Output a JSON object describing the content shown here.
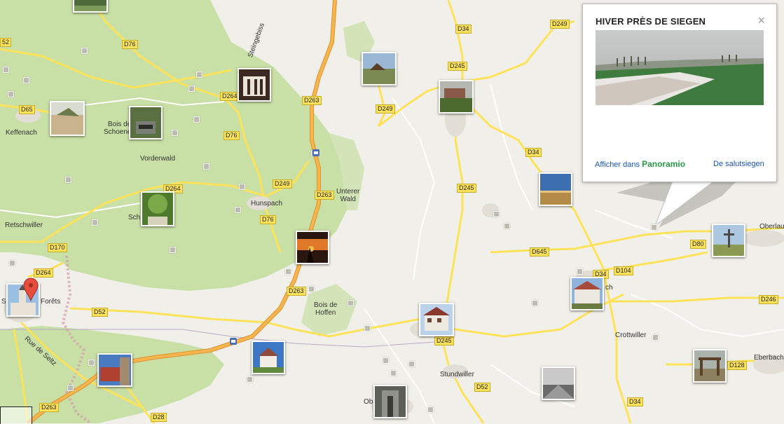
{
  "places": {
    "keffenach": "Keffenach",
    "bois_schoenen": "Bois de\nSchoenen",
    "vorderwald": "Vorderwald",
    "hunspach": "Hunspach",
    "retschwiller": "Retschwiller",
    "schoenenbourg_partial": "Sch",
    "forets": "Forêts",
    "forets_prefix": "Sc",
    "unterer_wald": "Unterer\nWald",
    "bois_hoffen": "Bois de\nHoffen",
    "crottwiller": "Crottwiller",
    "stundwiller": "Stundwiller",
    "oberlau": "Oberlau",
    "eberbach": "Eberbach",
    "ob_partial": "Ob",
    "ch_partial": "ch",
    "rue_seltz": "Rue de Seltz",
    "steingebiss": "Steingebiss"
  },
  "roads": {
    "d76a": "D76",
    "d76b": "D76",
    "d76c": "D76",
    "d65": "D65",
    "d52a": "52",
    "d264a": "D264",
    "d264b": "D264",
    "d264c": "D264",
    "d263a": "D263",
    "d263b": "D263",
    "d263c": "D263",
    "d263d": "D263",
    "d249a": "D249",
    "d249b": "D249",
    "d249c": "D249",
    "d34a": "D34",
    "d34b": "D34",
    "d34c": "D34",
    "d34d": "D34",
    "d245a": "D245",
    "d245b": "D245",
    "d245c": "D245",
    "d170": "D170",
    "d52b": "D52",
    "d52c": "D52",
    "d645": "D645",
    "d104": "D104",
    "d80": "D80",
    "d246": "D246",
    "d128": "D128",
    "d28": "D28"
  },
  "popup": {
    "title": "HIVER PRÈS DE SIEGEN",
    "close": "×",
    "view_prefix": "Afficher dans ",
    "panoramio": "Panoramio",
    "author": "De salutsiegen"
  },
  "colors": {
    "forest": "#c8dfa5",
    "background": "#f1efe9",
    "highway": "#f7a93a",
    "minor_road": "#fde25a",
    "marker": "#e84c3d",
    "link": "#1a55b4",
    "panoramio_green": "#2a9a48"
  }
}
